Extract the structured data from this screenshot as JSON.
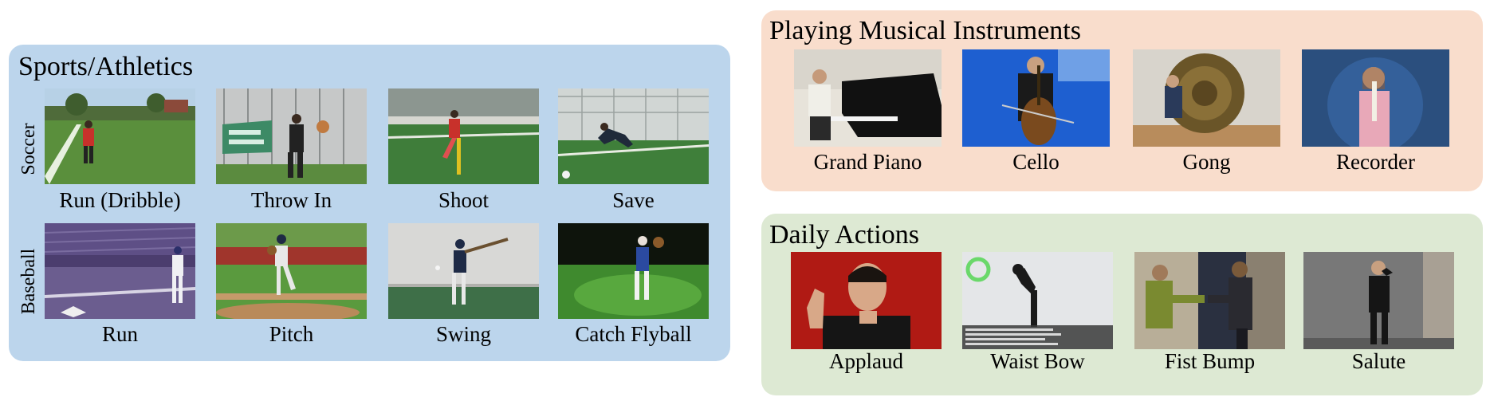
{
  "sports": {
    "title": "Sports/Athletics",
    "rows": [
      "Soccer",
      "Baseball"
    ],
    "captions": [
      "Run (Dribble)",
      "Throw In",
      "Shoot",
      "Save",
      "Run",
      "Pitch",
      "Swing",
      "Catch Flyball"
    ]
  },
  "music": {
    "title": "Playing Musical Instruments",
    "captions": [
      "Grand Piano",
      "Cello",
      "Gong",
      "Recorder"
    ]
  },
  "daily": {
    "title": "Daily Actions",
    "captions": [
      "Applaud",
      "Waist Bow",
      "Fist Bump",
      "Salute"
    ]
  },
  "colors": {
    "sports_bg": "#bcd5ec",
    "music_bg": "#f9ddcc",
    "daily_bg": "#dde9d3"
  }
}
